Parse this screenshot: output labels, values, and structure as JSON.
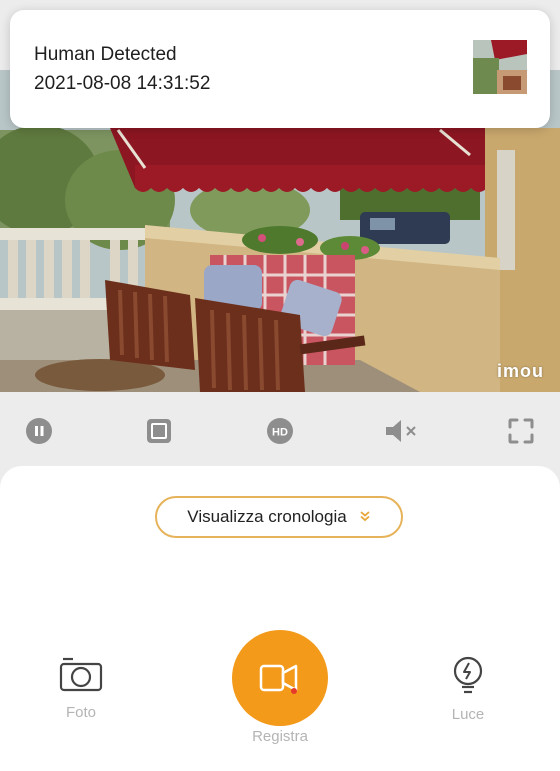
{
  "notification": {
    "title": "Human Detected",
    "time": "2021-08-08 14:31:52"
  },
  "video": {
    "watermark": "imou"
  },
  "controls": {
    "items": [
      {
        "name": "pause",
        "icon": "pause-icon"
      },
      {
        "name": "stop",
        "icon": "stop-icon"
      },
      {
        "name": "hd",
        "icon": "hd-icon",
        "label": "HD"
      },
      {
        "name": "mute",
        "icon": "speaker-muted-icon"
      },
      {
        "name": "fullscreen",
        "icon": "fullscreen-icon"
      }
    ]
  },
  "panel": {
    "history_label": "Visualizza cronologia",
    "actions": [
      {
        "label": "Foto",
        "icon": "camera-icon"
      },
      {
        "label": "Registra",
        "icon": "video-record-icon"
      },
      {
        "label": "Luce",
        "icon": "light-bulb-icon"
      }
    ]
  },
  "colors": {
    "accent": "#f39a1b",
    "accent_border": "#e7b35a",
    "icon_gray": "#8e8e8e",
    "label_gray": "#b4b4b4"
  }
}
